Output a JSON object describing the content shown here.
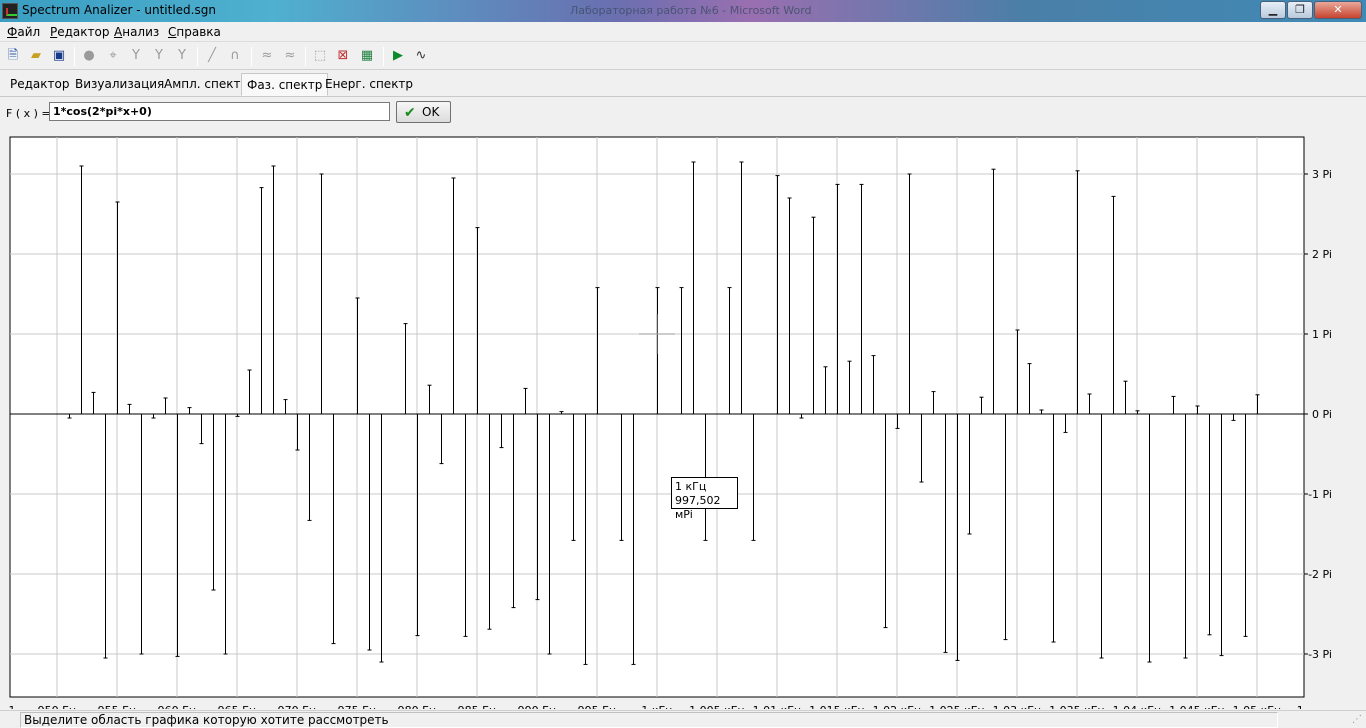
{
  "window": {
    "title": "Spectrum Analizer - untitled.sgn",
    "background_title": "Лабораторная работа №6 - Microsoft Word",
    "min_label": "0",
    "max_label": "1",
    "close_label": "r"
  },
  "menu": {
    "items": [
      {
        "first": "Ф",
        "rest": "айл"
      },
      {
        "first": "Р",
        "rest": "едактор"
      },
      {
        "first": "А",
        "rest": "нализ"
      },
      {
        "first": "С",
        "rest": "правка"
      }
    ]
  },
  "toolbar": {
    "icons": [
      "new-file-icon",
      "open-folder-icon",
      "save-icon",
      "zoom-icon",
      "crosshair-icon",
      "marker-icon",
      "marker-range-icon",
      "marker-multi-icon",
      "line-icon",
      "curve-icon",
      "filter-icon",
      "filter-alt-icon",
      "zoom-region-icon",
      "zoom-reset-icon",
      "zoom-fit-icon",
      "play-icon",
      "waveform-icon"
    ]
  },
  "tabs": [
    {
      "label": "Редактор",
      "active": false
    },
    {
      "label": "Визуализация",
      "active": false
    },
    {
      "label": "Ампл. спектр",
      "active": false
    },
    {
      "label": "Фаз. спектр",
      "active": true
    },
    {
      "label": "Енерг. спектр",
      "active": false
    }
  ],
  "formula": {
    "label": "F ( x ) =",
    "value": "1*cos(2*pi*x+0)",
    "ok_label": "OK"
  },
  "tooltip": {
    "line1": "1 кГц",
    "line2": "997,502 мPi"
  },
  "status": {
    "text": "Выделите область графика которую хотите рассмотреть"
  },
  "chart_data": {
    "type": "bar",
    "x_unit": "Hz",
    "y_unit": "Pi",
    "ylim": [
      -3.3,
      3.3
    ],
    "xlim": [
      946.5,
      1053.5
    ],
    "grid": true,
    "x_ticks": [
      {
        "x": 946,
        "label": "1"
      },
      {
        "x": 950,
        "label": "950 Гц"
      },
      {
        "x": 955,
        "label": "955 Гц"
      },
      {
        "x": 960,
        "label": "960 Гц"
      },
      {
        "x": 965,
        "label": "965 Гц"
      },
      {
        "x": 970,
        "label": "970 Гц"
      },
      {
        "x": 975,
        "label": "975 Гц"
      },
      {
        "x": 980,
        "label": "980 Гц"
      },
      {
        "x": 985,
        "label": "985 Гц"
      },
      {
        "x": 990,
        "label": "990 Гц"
      },
      {
        "x": 995,
        "label": "995 Гц"
      },
      {
        "x": 1000,
        "label": "1 кГц"
      },
      {
        "x": 1005,
        "label": "1,005 кГц"
      },
      {
        "x": 1010,
        "label": "1,01 кГц"
      },
      {
        "x": 1015,
        "label": "1,015 кГц"
      },
      {
        "x": 1020,
        "label": "1,02 кГц"
      },
      {
        "x": 1025,
        "label": "1,025 кГц"
      },
      {
        "x": 1030,
        "label": "1,03 кГц"
      },
      {
        "x": 1035,
        "label": "1,035 кГц"
      },
      {
        "x": 1040,
        "label": "1,04 кГц"
      },
      {
        "x": 1045,
        "label": "1,045 кГц"
      },
      {
        "x": 1050,
        "label": "1,05 кГц"
      },
      {
        "x": 1054,
        "label": "1,"
      }
    ],
    "y_ticks": [
      {
        "y": 3,
        "label": "3 Pi"
      },
      {
        "y": 2,
        "label": "2 Pi"
      },
      {
        "y": 1,
        "label": "1 Pi"
      },
      {
        "y": 0,
        "label": "0 Pi"
      },
      {
        "y": -1,
        "label": "-1 Pi"
      },
      {
        "y": -2,
        "label": "-2 Pi"
      },
      {
        "y": -3,
        "label": "-3 Pi"
      }
    ],
    "x": [
      951,
      952,
      953,
      954,
      955,
      956,
      957,
      958,
      959,
      960,
      961,
      962,
      963,
      964,
      965,
      966,
      967,
      968,
      969,
      970,
      971,
      972,
      973,
      974,
      975,
      976,
      977,
      978,
      979,
      980,
      981,
      982,
      983,
      984,
      985,
      986,
      987,
      988,
      989,
      990,
      991,
      992,
      993,
      994,
      995,
      996,
      997,
      998,
      999,
      1000,
      1001,
      1002,
      1003,
      1004,
      1005,
      1006,
      1007,
      1008,
      1009,
      1010,
      1011,
      1012,
      1013,
      1014,
      1015,
      1016,
      1017,
      1018,
      1019,
      1020,
      1021,
      1022,
      1023,
      1024,
      1025,
      1026,
      1027,
      1028,
      1029,
      1030,
      1031,
      1032,
      1033,
      1034,
      1035,
      1036,
      1037,
      1038,
      1039,
      1040,
      1041,
      1042,
      1043,
      1044,
      1045,
      1046,
      1047,
      1048,
      1049,
      1050
    ],
    "values": [
      -0.05,
      3.1,
      0.27,
      -3.05,
      2.65,
      0.12,
      -3.0,
      -0.05,
      0.2,
      -3.03,
      0.08,
      -0.37,
      -2.2,
      -3.0,
      -0.03,
      0.55,
      2.83,
      3.1,
      0.18,
      -0.45,
      -1.33,
      3.0,
      -2.87,
      0.0,
      1.45,
      -2.95,
      -3.1,
      0.0,
      1.13,
      -2.77,
      0.36,
      -0.62,
      2.95,
      -2.78,
      2.33,
      -2.69,
      -0.42,
      -2.42,
      0.32,
      -2.32,
      -3.0,
      0.03,
      -1.58,
      -3.13,
      1.58,
      0.0,
      -1.58,
      -3.13,
      0.0,
      1.58,
      0.0,
      1.58,
      3.15,
      -1.58,
      0.0,
      1.58,
      3.15,
      -1.58,
      0.0,
      2.98,
      2.7,
      -0.05,
      2.46,
      0.59,
      2.87,
      0.66,
      2.87,
      0.73,
      -2.67,
      -0.18,
      3.0,
      -0.85,
      0.28,
      -2.98,
      -3.08,
      -1.5,
      0.21,
      3.06,
      -2.82,
      1.05,
      0.63,
      0.05,
      -2.85,
      -0.23,
      3.04,
      0.25,
      -3.05,
      2.72,
      0.41,
      0.04,
      -3.1,
      0.0,
      0.22,
      -3.05,
      0.1,
      -2.76,
      -3.02,
      -0.08,
      -2.78,
      0.24
    ]
  }
}
